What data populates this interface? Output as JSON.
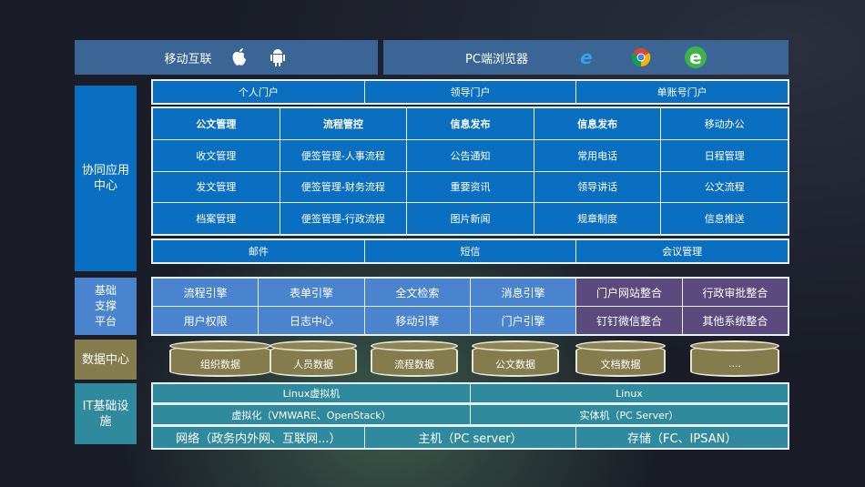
{
  "top": {
    "mobile": "移动互联",
    "pc": "PC端浏览器",
    "icons": [
      "apple-icon",
      "android-icon",
      "ie-icon",
      "chrome-icon",
      "360-browser-icon"
    ]
  },
  "left": {
    "collab": "协同应用中心",
    "platform": "基础支撑平台",
    "data": "数据中心",
    "it": "IT基础设施"
  },
  "portals": [
    "个人门户",
    "领导门户",
    "单账号门户"
  ],
  "apps": {
    "headers": [
      "公文管理",
      "流程管控",
      "信息发布",
      "信息发布",
      "移动办公"
    ],
    "rows": [
      [
        "收文管理",
        "便签管理-人事流程",
        "公告通知",
        "常用电话",
        "日程管理"
      ],
      [
        "发文管理",
        "便签管理-财务流程",
        "重要资讯",
        "领导讲话",
        "公文流程"
      ],
      [
        "档案管理",
        "便签管理-行政流程",
        "图片新闻",
        "规章制度",
        "信息推送"
      ]
    ]
  },
  "comm": [
    "邮件",
    "短信",
    "会议管理"
  ],
  "platform": [
    [
      "流程引擎",
      "表单引擎",
      "全文检索",
      "消息引擎",
      "门户网站整合",
      "行政审批整合"
    ],
    [
      "用户权限",
      "日志中心",
      "移动引擎",
      "门户引擎",
      "钉钉微信整合",
      "其他系统整合"
    ]
  ],
  "datacenter": [
    "组织数据",
    "人员数据",
    "流程数据",
    "公文数据",
    "文档数据",
    "...."
  ],
  "it": {
    "row1": [
      "Linux虚拟机",
      "Linux"
    ],
    "row2": [
      "虚拟化（VMWARE、OpenStack）",
      "实体机（PC Server）"
    ],
    "row3": [
      "网络（政务内外网、互联网...）",
      "主机（PC server）",
      "存储（FC、IPSAN）"
    ]
  }
}
